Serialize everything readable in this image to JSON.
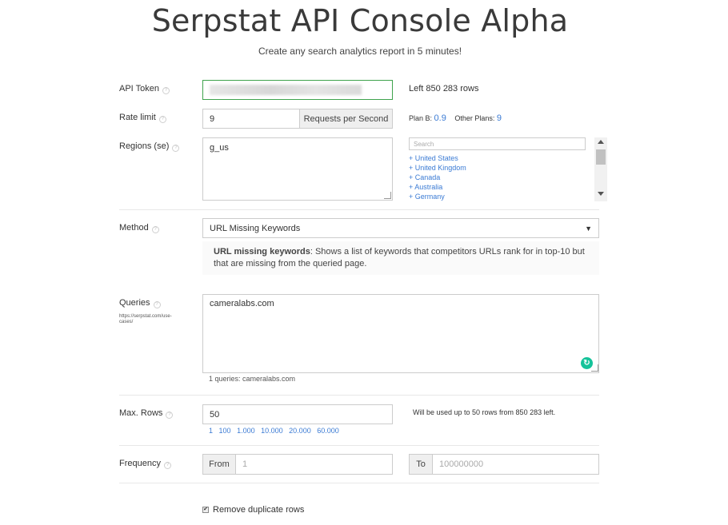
{
  "header": {
    "title": "Serpstat API Console Alpha",
    "subtitle": "Create any search analytics report in 5 minutes!"
  },
  "api_token": {
    "label": "API Token",
    "rows_left": "Left 850 283 rows"
  },
  "rate_limit": {
    "label": "Rate limit",
    "value": "9",
    "addon": "Requests per Second",
    "plan_b_label": "Plan B:",
    "plan_b_value": "0.9",
    "other_label": "Other Plans:",
    "other_value": "9"
  },
  "regions": {
    "label": "Regions (se)",
    "value": "g_us",
    "search_placeholder": "Search",
    "options": [
      "+ United States",
      "+ United Kingdom",
      "+ Canada",
      "+ Australia",
      "+ Germany"
    ]
  },
  "method": {
    "label": "Method",
    "selected": "URL Missing Keywords",
    "desc_title": "URL missing keywords",
    "desc_text": ": Shows a list of keywords that competitors URLs rank for in top-10 but that are missing from the queried page."
  },
  "queries": {
    "label": "Queries",
    "link": "https://serpstat.com/use-cases/",
    "value": "cameralabs.com",
    "count_text": "1 queries: cameralabs.com"
  },
  "max_rows": {
    "label": "Max. Rows",
    "value": "50",
    "presets": [
      "1",
      "100",
      "1.000",
      "10.000",
      "20.000",
      "60.000"
    ],
    "note": "Will be used up to 50 rows from 850 283 left."
  },
  "frequency": {
    "label": "Frequency",
    "from_label": "From",
    "from_placeholder": "1",
    "to_label": "To",
    "to_placeholder": "100000000"
  },
  "options": {
    "remove_duplicates": "Remove duplicate rows",
    "remove_duplicates_checked": true
  },
  "colors": {
    "link": "#3b7bd4",
    "token_border": "#3fa34d",
    "grammarly": "#15c39a"
  }
}
